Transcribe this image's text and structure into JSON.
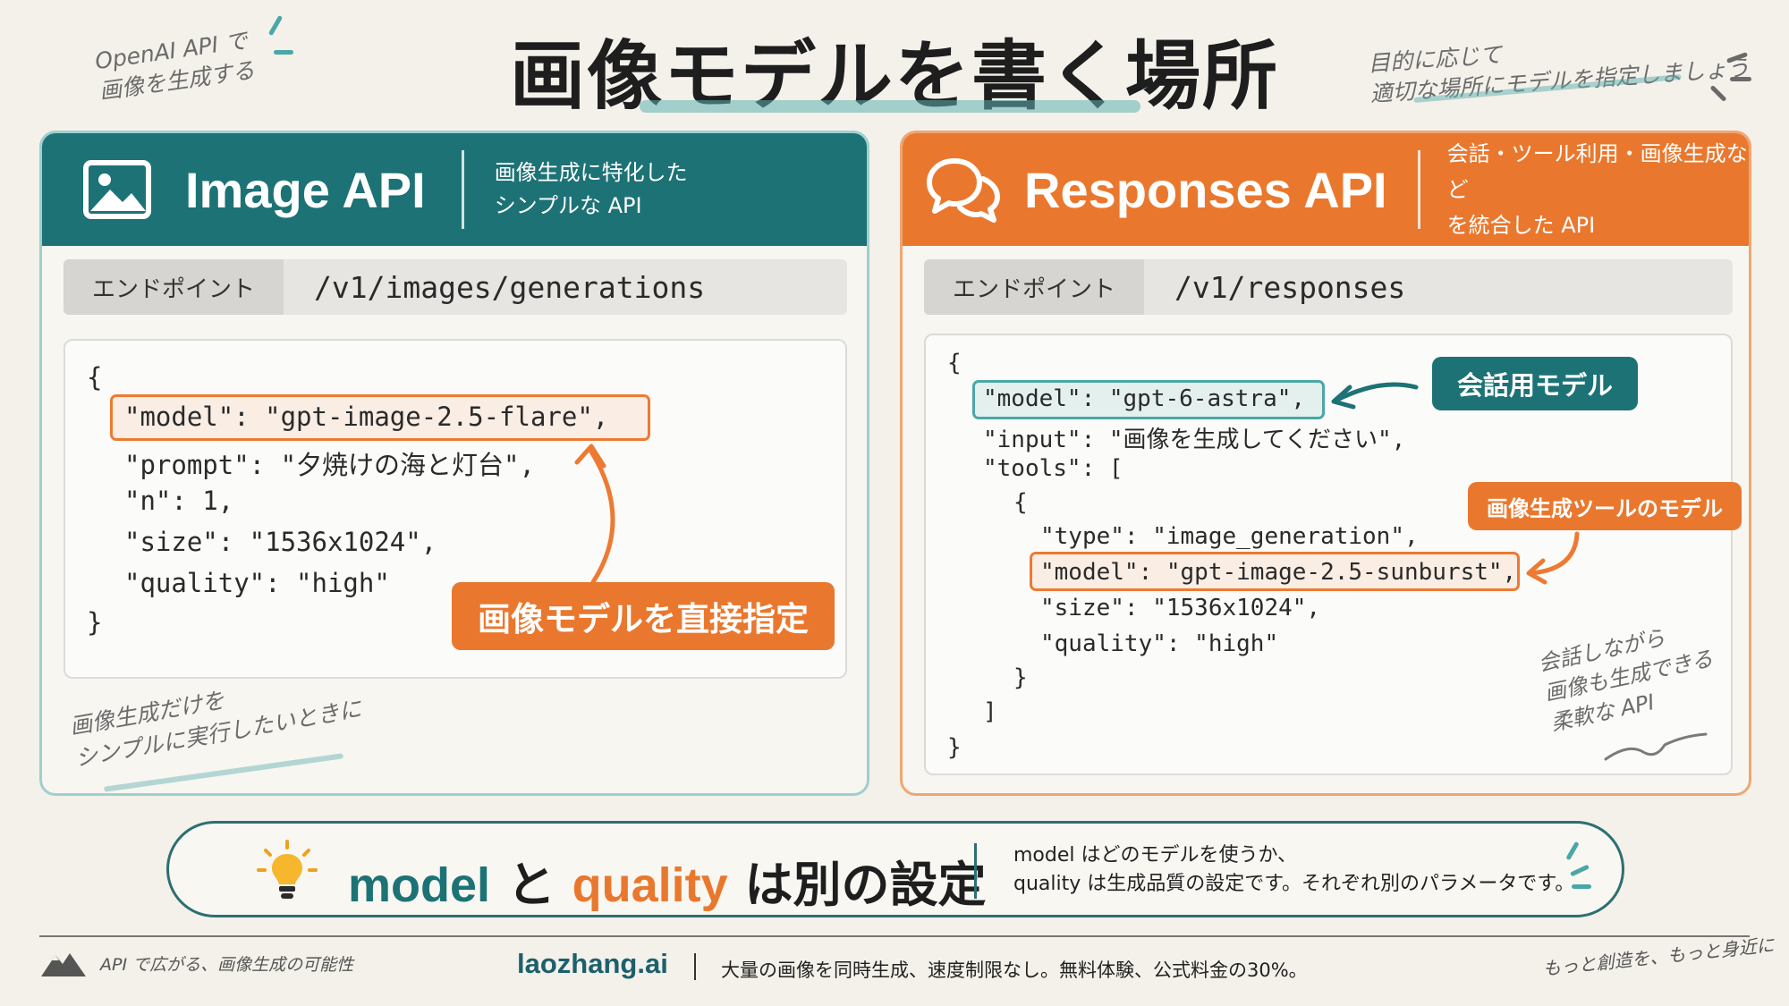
{
  "title": "画像モデルを書く場所",
  "notes": {
    "top_left": [
      "OpenAI API で",
      "画像を生成する"
    ],
    "top_right": [
      "目的に応じて",
      "適切な場所にモデルを指定しましょう"
    ]
  },
  "image_api": {
    "title": "Image API",
    "desc": [
      "画像生成に特化した",
      "シンプルな API"
    ],
    "endpoint_label": "エンドポイント",
    "endpoint": "/v1/images/generations",
    "code": [
      "{",
      "\"model\": \"gpt-image-2.5-flare\",",
      "\"prompt\": \"夕焼けの海と灯台\",",
      "\"n\": 1,",
      "\"size\": \"1536x1024\",",
      "\"quality\": \"high\"",
      "}"
    ],
    "badge": "画像モデルを直接指定",
    "note": [
      "画像生成だけを",
      "シンプルに実行したいときに"
    ]
  },
  "responses_api": {
    "title": "Responses API",
    "desc": [
      "会話・ツール利用・画像生成など",
      "を統合した API"
    ],
    "endpoint_label": "エンドポイント",
    "endpoint": "/v1/responses",
    "code": [
      "{",
      "\"model\": \"gpt-6-astra\",",
      "\"input\": \"画像を生成してください\",",
      "\"tools\": [",
      "{",
      "\"type\": \"image_generation\",",
      "\"model\": \"gpt-image-2.5-sunburst\",",
      "\"size\": \"1536x1024\",",
      "\"quality\": \"high\"",
      "}",
      "]",
      "}"
    ],
    "badge_chat": "会話用モデル",
    "badge_tool": "画像生成ツールのモデル",
    "note": [
      "会話しながら",
      "画像も生成できる",
      "柔軟な API"
    ]
  },
  "bottom": {
    "word_model": "model",
    "word_to": "と",
    "word_quality": "quality",
    "word_rest": "は別の設定",
    "desc": [
      "model はどのモデルを使うか、",
      "quality は生成品質の設定です。それぞれ別のパラメータです。"
    ]
  },
  "footer": {
    "left": "API で広がる、画像生成の可能性",
    "brand": "laozhang.ai",
    "text": "大量の画像を同時生成、速度制限なし。無料体験、公式料金の30%。",
    "right": "もっと創造を、もっと身近に"
  },
  "colors": {
    "teal": "#1d7275",
    "orange": "#e9782e",
    "background": "#f3f1ea"
  },
  "icons": [
    "image-icon",
    "chat-bubbles-icon",
    "lightbulb-icon",
    "mountain-logo-icon"
  ]
}
